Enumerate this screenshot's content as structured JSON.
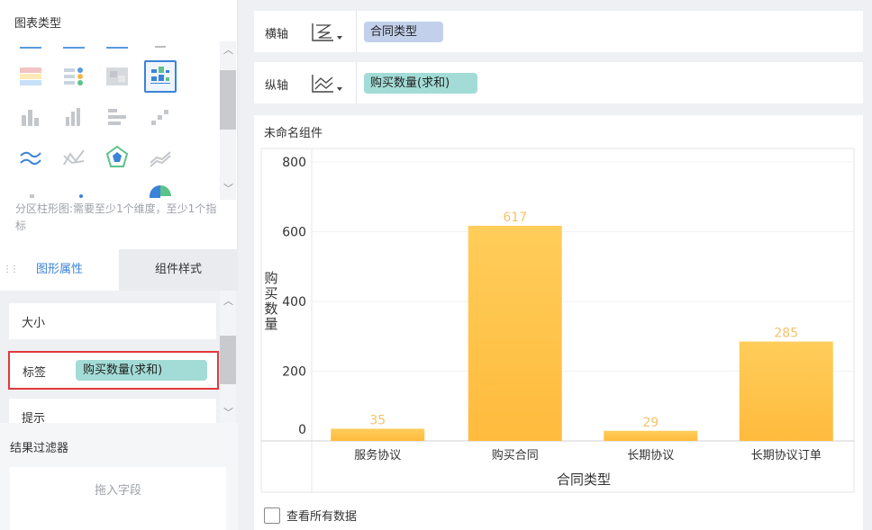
{
  "left_panel": {
    "chart_type_title": "图表类型",
    "chart_hint": "分区柱形图:需要至少1个维度，至少1个指标",
    "tabs": {
      "graph_props": "图形属性",
      "component_style": "组件样式"
    },
    "attributes": {
      "size": "大小",
      "label": "标签",
      "label_field": "购买数量(求和)",
      "tip": "提示"
    },
    "filter": {
      "title": "结果过滤器",
      "drop_hint": "拖入字段"
    }
  },
  "axes_config": {
    "x": {
      "label": "横轴",
      "field": "合同类型"
    },
    "y": {
      "label": "纵轴",
      "field": "购买数量(求和)"
    }
  },
  "chart_panel": {
    "component_name": "未命名组件",
    "show_all_data": "查看所有数据"
  },
  "colors": {
    "accent": "#3b83d9",
    "bar": "#ffc64b",
    "label": "#f5c36b",
    "highlight": "#e0393e"
  },
  "chart_data": {
    "type": "bar",
    "categories": [
      "服务协议",
      "购买合同",
      "长期协议",
      "长期协议订单"
    ],
    "values": [
      35,
      617,
      29,
      285
    ],
    "xlabel": "合同类型",
    "ylabel": "购买数量",
    "yticks": [
      "800",
      "600",
      "400",
      "200",
      "0"
    ],
    "ylim": [
      0,
      800
    ],
    "data_labels": [
      "35",
      "617",
      "29",
      "285"
    ],
    "grid": true
  }
}
